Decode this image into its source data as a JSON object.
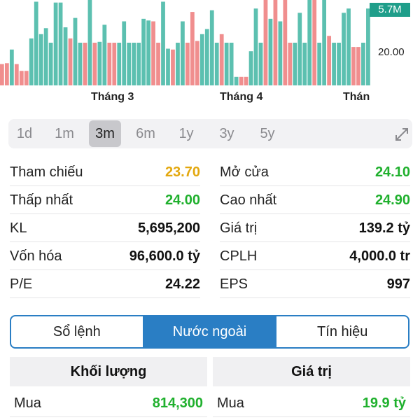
{
  "chart": {
    "volume_badge": "5.7M",
    "y_tick": "20.00",
    "x_ticks": [
      "Tháng 3",
      "Tháng 4",
      "Thán"
    ],
    "colors": {
      "up": "#5cc0b0",
      "down": "#f08e8e"
    }
  },
  "chart_data": {
    "type": "bar",
    "series_name": "volume",
    "directions": [
      "d",
      "d",
      "u",
      "d",
      "d",
      "d",
      "u",
      "u",
      "u",
      "u",
      "u",
      "u",
      "u",
      "u",
      "d",
      "u",
      "u",
      "d",
      "u",
      "d",
      "u",
      "u",
      "d",
      "d",
      "u",
      "u",
      "u",
      "u",
      "u",
      "u",
      "u",
      "d",
      "d",
      "u",
      "u",
      "d",
      "u",
      "u",
      "d",
      "d",
      "d",
      "u",
      "u",
      "u",
      "u",
      "d",
      "u",
      "u",
      "u",
      "d",
      "d",
      "u",
      "u",
      "u",
      "d",
      "u",
      "d",
      "u",
      "d",
      "d",
      "u",
      "u",
      "u",
      "u",
      "d",
      "u",
      "u",
      "d",
      "u",
      "u",
      "u",
      "u",
      "d",
      "d",
      "u",
      "u"
    ],
    "values": [
      0.25,
      0.26,
      0.42,
      0.25,
      0.17,
      0.17,
      0.55,
      0.98,
      0.6,
      0.67,
      0.5,
      0.97,
      0.97,
      0.68,
      0.55,
      0.79,
      0.5,
      0.5,
      1.0,
      0.5,
      0.51,
      0.71,
      0.5,
      0.5,
      0.5,
      0.75,
      0.5,
      0.5,
      0.5,
      0.78,
      0.76,
      0.75,
      0.5,
      0.98,
      0.43,
      0.42,
      0.5,
      0.75,
      0.5,
      0.86,
      0.52,
      0.6,
      0.66,
      0.88,
      0.5,
      0.6,
      0.5,
      0.5,
      0.1,
      0.1,
      0.1,
      0.4,
      0.9,
      0.5,
      1.0,
      0.78,
      1.0,
      0.75,
      1.0,
      0.5,
      0.5,
      0.85,
      0.5,
      1.0,
      1.0,
      0.5,
      1.0,
      0.58,
      0.5,
      0.5,
      0.85,
      0.9,
      0.45,
      0.45,
      0.5,
      0.9
    ]
  },
  "range": {
    "options": [
      "1d",
      "1m",
      "3m",
      "6m",
      "1y",
      "3y",
      "5y"
    ],
    "selected": "3m"
  },
  "stats": {
    "left": [
      {
        "label": "Tham chiếu",
        "value": "23.70",
        "color": "yellow"
      },
      {
        "label": "Thấp nhất",
        "value": "24.00",
        "color": "green"
      },
      {
        "label": "KL",
        "value": "5,695,200",
        "color": "dark"
      },
      {
        "label": "Vốn hóa",
        "value": "96,600.0 tỷ",
        "color": "dark"
      },
      {
        "label": "P/E",
        "value": "24.22",
        "color": "dark"
      }
    ],
    "right": [
      {
        "label": "Mở cửa",
        "value": "24.10",
        "color": "green"
      },
      {
        "label": "Cao nhất",
        "value": "24.90",
        "color": "green"
      },
      {
        "label": "Giá trị",
        "value": "139.2 tỷ",
        "color": "dark"
      },
      {
        "label": "CPLH",
        "value": "4,000.0 tr",
        "color": "dark"
      },
      {
        "label": "EPS",
        "value": "997",
        "color": "dark"
      }
    ]
  },
  "tabs": {
    "items": [
      "Sổ lệnh",
      "Nước ngoài",
      "Tín hiệu"
    ],
    "active": "Nước ngoài"
  },
  "foreign": {
    "col1_header": "Khối lượng",
    "col2_header": "Giá trị",
    "buy_label": "Mua",
    "buy_volume": "814,300",
    "buy_label_2": "Mua",
    "buy_value": "19.9 tỷ"
  }
}
